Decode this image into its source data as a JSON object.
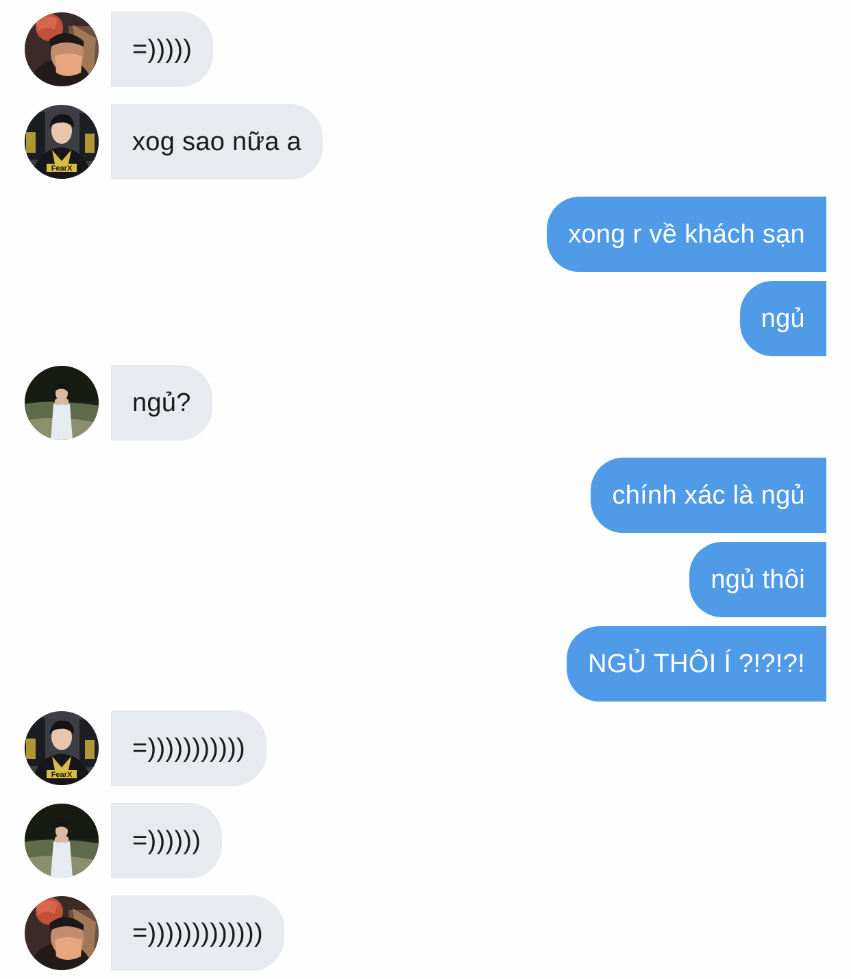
{
  "messages": [
    {
      "sender": "other",
      "avatar": "avatar-a",
      "text": "=)))))"
    },
    {
      "sender": "other",
      "avatar": "avatar-b",
      "text": "xog sao nữa a"
    },
    {
      "sender": "me",
      "text": "xong r về khách sạn"
    },
    {
      "sender": "me",
      "text": "ngủ"
    },
    {
      "sender": "other",
      "avatar": "avatar-c",
      "text": "ngủ?"
    },
    {
      "sender": "me",
      "text": "chính xác là ngủ"
    },
    {
      "sender": "me",
      "text": "ngủ thôi"
    },
    {
      "sender": "me",
      "text": "NGỦ THÔI Í ?!?!?!"
    },
    {
      "sender": "other",
      "avatar": "avatar-b",
      "text": "=)))))))))))"
    },
    {
      "sender": "other",
      "avatar": "avatar-c",
      "text": "=))))))"
    },
    {
      "sender": "other",
      "avatar": "avatar-a",
      "text": "=)))))))))))))"
    }
  ],
  "colors": {
    "background": "#fefefe",
    "incoming_bubble": "#e7eaef",
    "incoming_text": "#1a1a1a",
    "outgoing_bubble": "#4f9be8",
    "outgoing_text": "#ffffff"
  },
  "avatar_logo_text": "FearX"
}
